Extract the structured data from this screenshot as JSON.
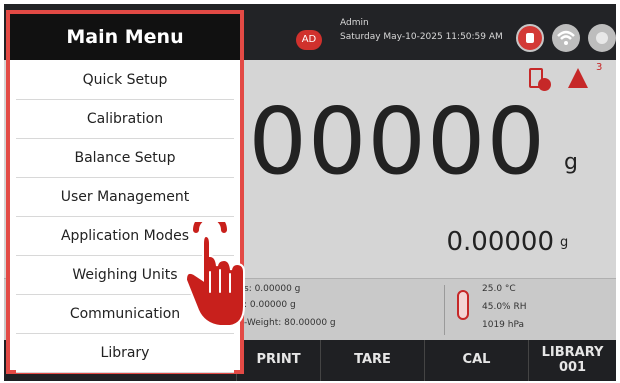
{
  "header": {
    "avatar_initials": "AD",
    "user_name": "Admin",
    "datetime": "Saturday May-10-2025 11:50:59 AM"
  },
  "status": {
    "alarm_count": "3",
    "icons": [
      "lock-icon",
      "wifi-icon",
      "power-icon",
      "battery-check-icon",
      "alarm-icon"
    ]
  },
  "display": {
    "main_weight": "0.00000",
    "main_unit": "g",
    "secondary_weight": "0.00000",
    "secondary_unit": "g"
  },
  "info": {
    "line1": "s: 0.00000 g",
    "line2": ": 0.00000 g",
    "line3": "-Weight: 80.00000 g"
  },
  "environment": {
    "temperature": "25.0 °C",
    "humidity": "45.0% RH",
    "pressure": "1019 hPa"
  },
  "softkeys": [
    "PRINT",
    "TARE",
    "CAL",
    "LIBRARY 001"
  ],
  "menu": {
    "title": "Main Menu",
    "items": [
      "Quick Setup",
      "Calibration",
      "Balance Setup",
      "User Management",
      "Application Modes",
      "Weighing Units",
      "Communication",
      "Library"
    ]
  },
  "colors": {
    "accent_red": "#e34a45",
    "header_black": "#111111",
    "topbar": "#222326",
    "softkey_bar": "#1f2023"
  }
}
